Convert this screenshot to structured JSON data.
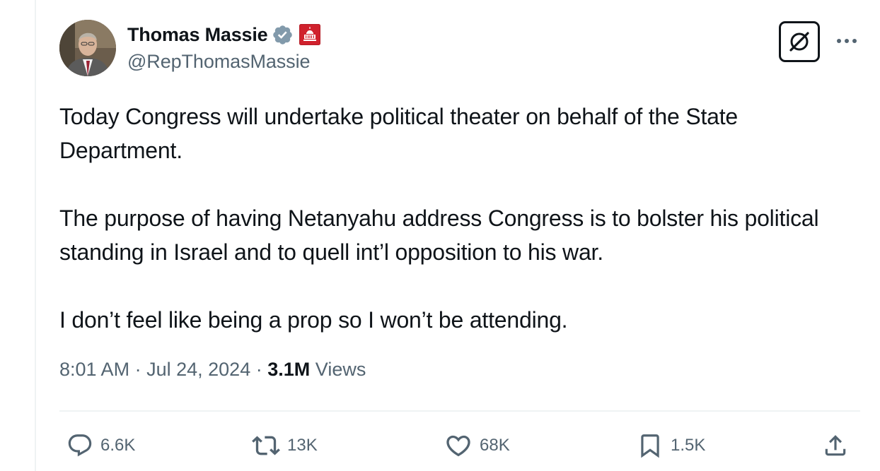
{
  "author": {
    "display_name": "Thomas Massie",
    "handle": "@RepThomasMassie",
    "verified_icon": "verified-badge-icon",
    "affiliation_icon": "us-capitol-badge-icon"
  },
  "tweet": {
    "paragraphs": [
      "Today Congress will undertake political theater on behalf of the State Department.",
      "The purpose of having Netanyahu address Congress is to bolster his political standing in Israel and to quell int’l opposition to his war.",
      "I don’t feel like being a prop so I won’t be attending."
    ],
    "time": "8:01 AM",
    "separator": "·",
    "date": "Jul 24, 2024",
    "views_count": "3.1M",
    "views_label": "Views"
  },
  "actions": {
    "replies": "6.6K",
    "reposts": "13K",
    "likes": "68K",
    "bookmarks": "1.5K"
  },
  "colors": {
    "text": "#0f1419",
    "secondary": "#536471",
    "verified": "#829aab",
    "gov_badge": "#d0212d",
    "divider": "#eff3f4"
  }
}
